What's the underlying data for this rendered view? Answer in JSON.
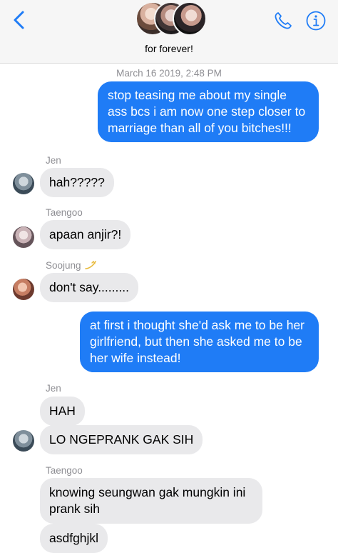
{
  "header": {
    "group_name": "for forever!",
    "back_icon": "chevron-left-icon",
    "phone_icon": "phone-icon",
    "info_icon": "info-icon",
    "accent_color": "#1f7cf6"
  },
  "timestamp": "March 16 2019, 2:48 PM",
  "messages": [
    {
      "sender": "",
      "direction": "outgoing",
      "text": "stop teasing me about my single ass bcs i am now one step closer to marriage than all of you bitches!!!"
    },
    {
      "sender": "Jen",
      "direction": "incoming",
      "text": "hah?????"
    },
    {
      "sender": "Taengoo",
      "direction": "incoming",
      "text": "apaan anjir?!"
    },
    {
      "sender": "Soojung",
      "direction": "incoming",
      "text": "don't say........."
    },
    {
      "sender": "",
      "direction": "outgoing",
      "text": "at first i thought she'd ask me to be her girlfriend, but then she asked me to be her wife instead!"
    },
    {
      "sender": "Jen",
      "direction": "incoming",
      "text": "HAH"
    },
    {
      "sender": "",
      "direction": "incoming",
      "text": "LO NGEPRANK GAK SIH"
    },
    {
      "sender": "Taengoo",
      "direction": "incoming",
      "text": "knowing seungwan gak mungkin ini prank sih"
    },
    {
      "sender": "",
      "direction": "incoming",
      "text": "asdfghjkl"
    }
  ],
  "colors": {
    "outgoing_bubble": "#1f7cf6",
    "incoming_bubble": "#e9e9eb",
    "meta_text": "#8e8e93"
  }
}
